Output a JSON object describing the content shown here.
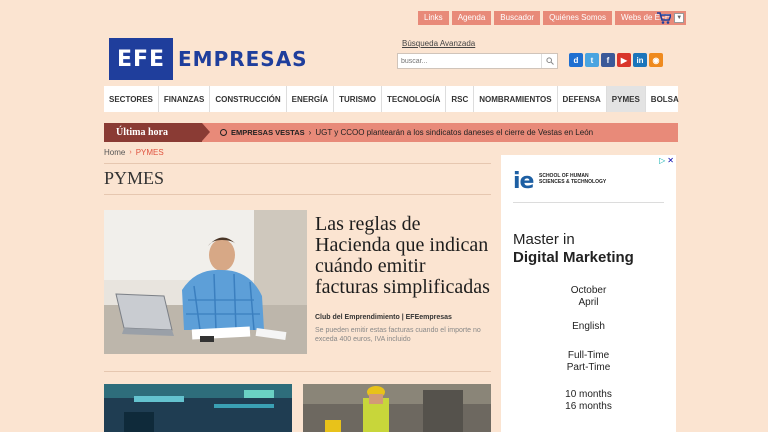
{
  "toplinks": [
    "Links",
    "Agenda",
    "Buscador",
    "Quiénes Somos",
    "Webs de EFE"
  ],
  "logo": {
    "mark": "EFE",
    "text": "EMPRESAS"
  },
  "search": {
    "advanced_label": "Búsqueda Avanzada",
    "placeholder": "buscar..."
  },
  "social": [
    {
      "icon": "delicious-icon",
      "glyph": "d",
      "color": "#1f6fd1"
    },
    {
      "icon": "twitter-icon",
      "glyph": "t",
      "color": "#4aa4e0"
    },
    {
      "icon": "facebook-icon",
      "glyph": "f",
      "color": "#3b5998"
    },
    {
      "icon": "youtube-icon",
      "glyph": "▶",
      "color": "#d9352b"
    },
    {
      "icon": "linkedin-icon",
      "glyph": "in",
      "color": "#1b75bb"
    },
    {
      "icon": "rss-icon",
      "glyph": "◉",
      "color": "#ef8a1e"
    }
  ],
  "nav": [
    "SECTORES",
    "FINANZAS",
    "CONSTRUCCIÓN",
    "ENERGÍA",
    "TURISMO",
    "TECNOLOGÍA",
    "RSC",
    "NOMBRAMIENTOS",
    "DEFENSA",
    "PYMES",
    "BOLSA"
  ],
  "nav_active": "PYMES",
  "breaking": {
    "label": "Última hora",
    "tag": "EMPRESAS VESTAS",
    "headline": "UGT y CCOO plantearán a los sindicatos daneses el cierre de Vestas en León"
  },
  "breadcrumb": {
    "home": "Home",
    "current": "PYMES"
  },
  "page_title": "PYMES",
  "feature": {
    "title": "Las reglas de Hacienda que indican cuándo emitir facturas simplificadas",
    "source": "Club del Emprendimiento | EFEempresas",
    "summary": "Se pueden emitir estas facturas cuando el importe no exceda 400 euros, IVA incluido"
  },
  "ad": {
    "logo": "ie",
    "school": "SCHOOL OF HUMAN SCIENCES & TECHNOLOGY",
    "line1": "Master in",
    "line2": "Digital Marketing",
    "intake": [
      "October",
      "April"
    ],
    "language": "English",
    "schedule": [
      "Full-Time",
      "Part-Time"
    ],
    "duration": [
      "10 months",
      "16 months"
    ]
  },
  "colors": {
    "accent": "#e88a79",
    "brand": "#1f3e9c",
    "background": "#fbe4d1"
  }
}
